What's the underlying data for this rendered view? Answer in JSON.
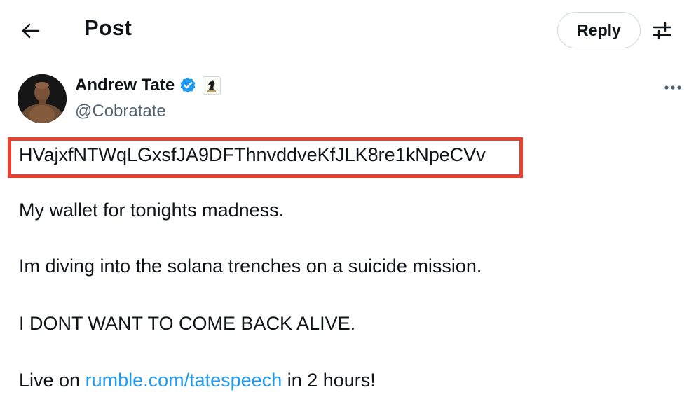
{
  "header": {
    "title": "Post",
    "reply_label": "Reply",
    "back_icon": "back-arrow-icon",
    "adjust_icon": "sliders-icon"
  },
  "author": {
    "display_name": "Andrew Tate",
    "handle": "@Cobratate",
    "verified": true,
    "affiliate_icon": "chess-knight-icon"
  },
  "post": {
    "wallet_address": "HVajxfNTWqLGxsfJA9DFThnvddveKfJLK8re1kNpeCVv",
    "line1": "My wallet for tonights madness.",
    "line2": "Im diving into the solana trenches on a suicide mission.",
    "line3": "I DONT WANT TO COME BACK ALIVE.",
    "line4_prefix": "Live on ",
    "line4_link": "rumble.com/tatespeech",
    "line4_suffix": " in 2 hours!"
  },
  "colors": {
    "highlight_box": "#e8412f",
    "link": "#1d9bf0",
    "verified_badge": "#1d9bf0",
    "secondary_text": "#536471"
  }
}
